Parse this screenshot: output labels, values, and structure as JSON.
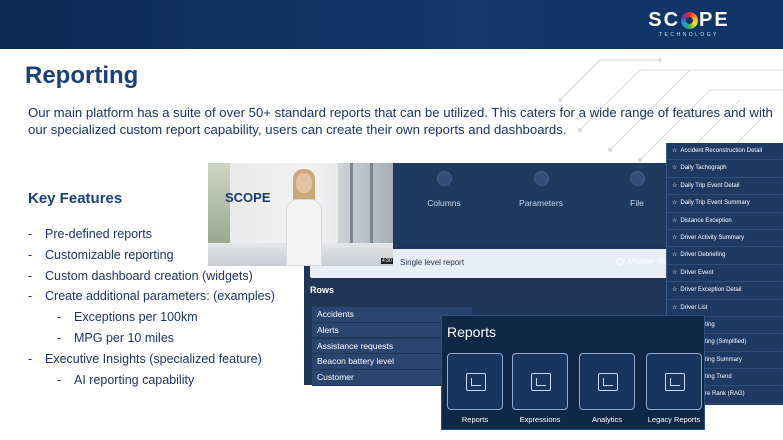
{
  "header": {
    "logo_text_left": "SC",
    "logo_text_right": "PE",
    "logo_subtitle": "TECHNOLOGY"
  },
  "title": "Reporting",
  "intro": "Our main platform has a suite of over 50+ standard reports that can be utilized. This caters for a wide range of features and with our specialized custom report capability, users can create their own reports and dashboards.",
  "key_features": {
    "title": "Key Features",
    "items": [
      {
        "text": "Pre-defined reports",
        "level": 1
      },
      {
        "text": "Customizable reporting",
        "level": 1
      },
      {
        "text": "Custom dashboard creation (widgets)",
        "level": 1
      },
      {
        "text": "Create additional parameters: (examples)",
        "level": 1
      },
      {
        "text": "Exceptions per 100km",
        "level": 2
      },
      {
        "text": "MPG per 10 miles",
        "level": 2
      },
      {
        "text": "Executive Insights (specialized feature)",
        "level": 1
      },
      {
        "text": "AI reporting capability",
        "level": 2
      }
    ]
  },
  "screenshot": {
    "video_sign": "SCOPE",
    "video_badge": "4:30",
    "wizard_steps": [
      "Columns",
      "Parameters",
      "File"
    ],
    "single_level": "Single level report",
    "master_detail": "Master-deta",
    "rows_title": "Rows",
    "rows": [
      "Accidents",
      "Alerts",
      "Assistance requests",
      "Beacon battery level",
      "Customer"
    ],
    "report_list": [
      "Accident Reconstruction Detail",
      "Daily Tachograph",
      "Daily Trip Event Detail",
      "Daily Trip Event Summary",
      "Distance Exception",
      "Driver Activity Summary",
      "Driver Debriefing",
      "Driver Event",
      "Driver Exception Detail",
      "Driver List",
      "ting",
      "ting (Simplified)",
      "ting Summary",
      "ting Trend",
      "re Rank (RAG)"
    ],
    "reports_title": "Reports",
    "report_tiles": [
      "Reports",
      "Expressions",
      "Analytics",
      "Legacy Reports"
    ]
  },
  "colors": {
    "header_bg": "#12386c",
    "title": "#1b3f7a",
    "body_text": "#1b3566",
    "panel_bg": "#1e3558"
  }
}
